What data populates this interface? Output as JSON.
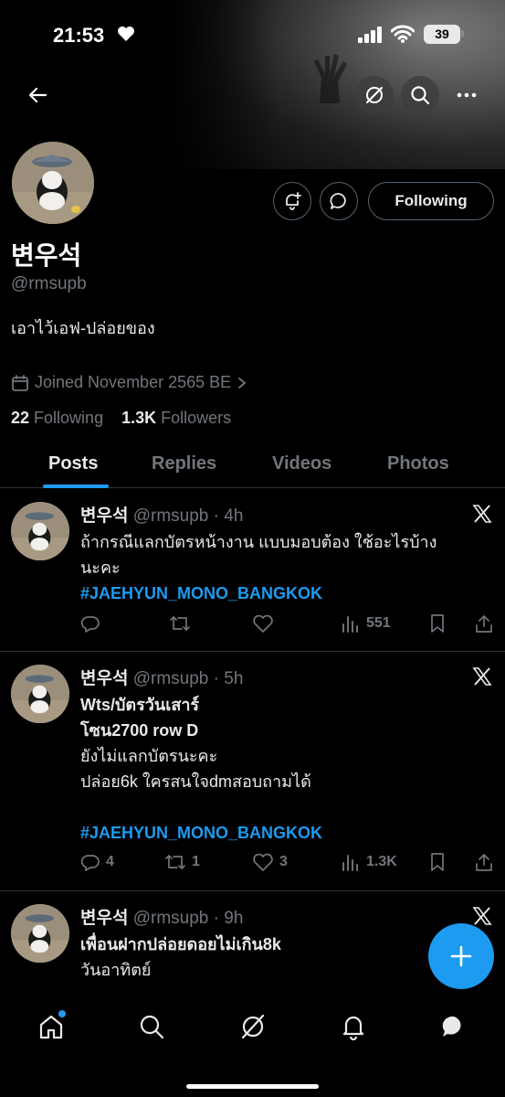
{
  "status_bar": {
    "time": "21:53",
    "battery": "39"
  },
  "profile": {
    "display_name": "변우석",
    "handle": "@rmsupb",
    "bio": "เอาไว้เอฟ-ปล่อยของ",
    "joined": "Joined November 2565 BE",
    "following_count": "22",
    "following_label": "Following",
    "followers_count": "1.3K",
    "followers_label": "Followers",
    "follow_button": "Following"
  },
  "tabs": [
    {
      "label": "Posts"
    },
    {
      "label": "Replies"
    },
    {
      "label": "Videos"
    },
    {
      "label": "Photos"
    }
  ],
  "posts": [
    {
      "name": "변우석",
      "meta": "@rmsupb · 4h",
      "lines": [
        "ถ้ากรณีแลกบัตรหน้างาน แบบมอบต้อง ใช้อะไรบ้าง",
        "นะคะ"
      ],
      "hashtag": "#JAEHYUN_MONO_BANGKOK",
      "replies": "",
      "reposts": "",
      "likes": "",
      "views": "551"
    },
    {
      "name": "변우석",
      "meta": "@rmsupb · 5h",
      "lines": [
        "Wts/บัตรวันเสาร์",
        "โซน2700 row D",
        "ยังไม่แลกบัตรนะคะ",
        "ปล่อย6k ใครสนใจdmสอบถามได้"
      ],
      "hashtag": "#JAEHYUN_MONO_BANGKOK",
      "replies": "4",
      "reposts": "1",
      "likes": "3",
      "views": "1.3K"
    },
    {
      "name": "변우석",
      "meta": "@rmsupb · 9h",
      "lines": [
        "เพื่อนฝากปล่อยดอยไม่เกิน8k",
        "วันอาทิตย์"
      ]
    }
  ]
}
